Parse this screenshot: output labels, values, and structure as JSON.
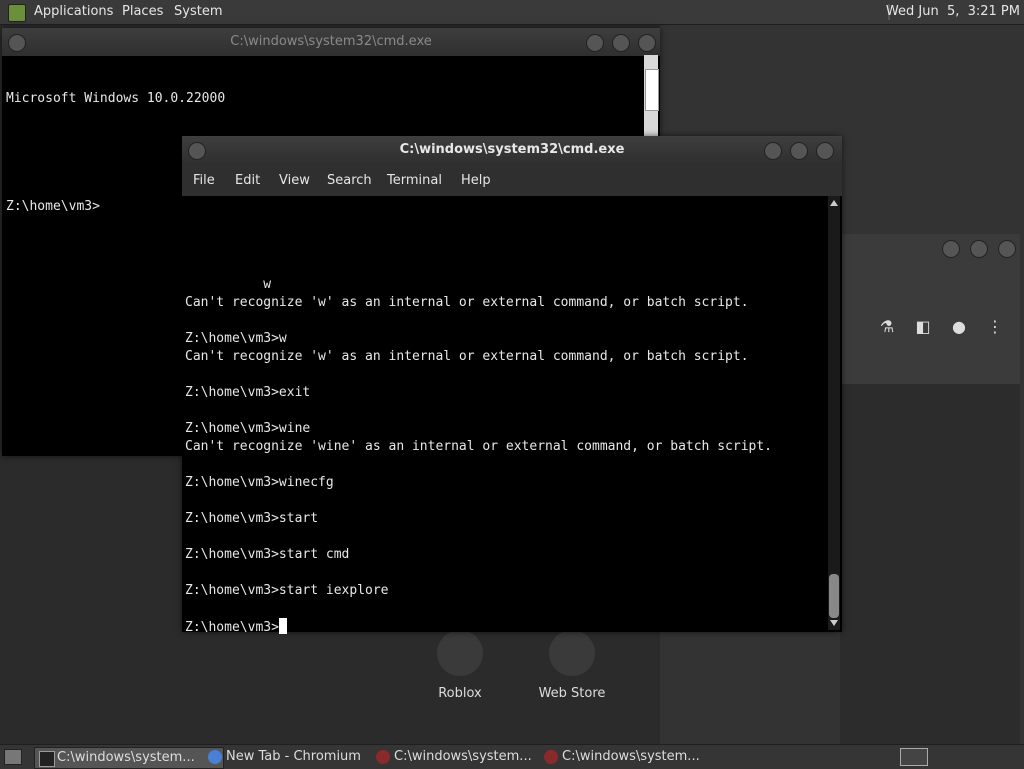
{
  "top_panel": {
    "menus": [
      "Applications",
      "Places",
      "System"
    ],
    "clock": "Wed Jun  5,  3:21 PM"
  },
  "back_window": {
    "title": "C:\\windows\\system32\\cmd.exe",
    "lines": [
      "Microsoft Windows 10.0.22000",
      "",
      "Z:\\home\\vm3>"
    ]
  },
  "front_window": {
    "title": "C:\\windows\\system32\\cmd.exe",
    "menu": [
      "File",
      "Edit",
      "View",
      "Search",
      "Terminal",
      "Help"
    ],
    "lines": [
      "",
      "",
      "",
      "",
      "          w",
      "Can't recognize 'w' as an internal or external command, or batch script.",
      "",
      "Z:\\home\\vm3>w",
      "Can't recognize 'w' as an internal or external command, or batch script.",
      "",
      "Z:\\home\\vm3>exit",
      "",
      "Z:\\home\\vm3>wine",
      "Can't recognize 'wine' as an internal or external command, or batch script.",
      "",
      "Z:\\home\\vm3>winecfg",
      "",
      "Z:\\home\\vm3>start",
      "",
      "Z:\\home\\vm3>start cmd",
      "",
      "Z:\\home\\vm3>start iexplore",
      ""
    ],
    "prompt": "Z:\\home\\vm3>"
  },
  "chromium": {
    "tiles": [
      "Roblox",
      "Web Store"
    ],
    "icons": [
      "flask-icon",
      "sidepanel-icon",
      "profile-icon",
      "more-vert-icon"
    ]
  },
  "taskbar": {
    "items": [
      {
        "label": "C:\\windows\\system...",
        "icon": "terminal-icon",
        "active": true
      },
      {
        "label": "New Tab - Chromium",
        "icon": "chromium-icon",
        "active": false
      },
      {
        "label": "C:\\windows\\system...",
        "icon": "wine-icon",
        "active": false
      },
      {
        "label": "C:\\windows\\system...",
        "icon": "wine-icon",
        "active": false
      }
    ]
  }
}
